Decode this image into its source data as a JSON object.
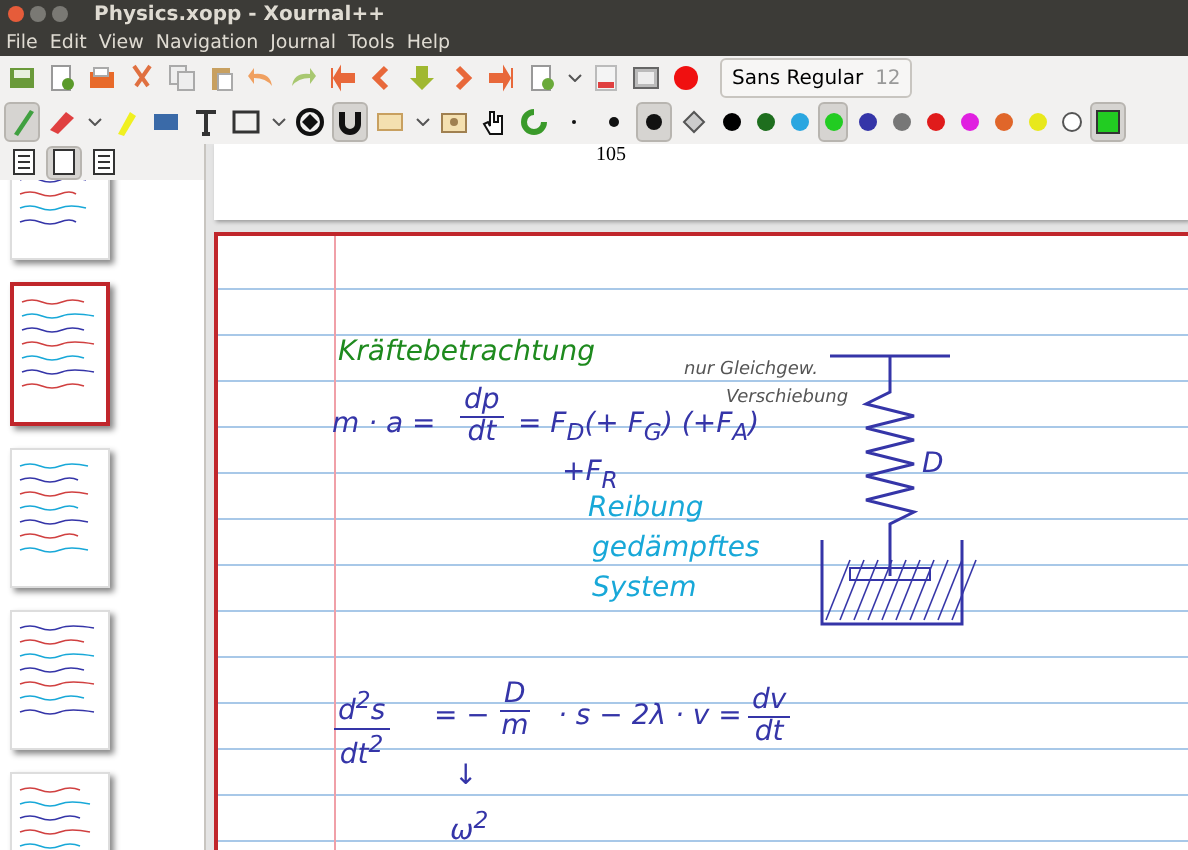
{
  "window": {
    "title": "Physics.xopp - Xournal++"
  },
  "menu": [
    "File",
    "Edit",
    "View",
    "Navigation",
    "Journal",
    "Tools",
    "Help"
  ],
  "toolbar_main": [
    {
      "kind": "save"
    },
    {
      "kind": "new"
    },
    {
      "kind": "open"
    },
    {
      "kind": "cut"
    },
    {
      "kind": "copy"
    },
    {
      "kind": "paste"
    },
    {
      "kind": "undo"
    },
    {
      "kind": "redo"
    },
    {
      "kind": "first"
    },
    {
      "kind": "prev"
    },
    {
      "kind": "goto"
    },
    {
      "kind": "next"
    },
    {
      "kind": "last"
    },
    {
      "kind": "addpage"
    },
    {
      "kind": "caret"
    },
    {
      "kind": "pdf"
    },
    {
      "kind": "fullscreen"
    },
    {
      "kind": "record"
    }
  ],
  "font_button": {
    "name": "Sans Regular",
    "size": "12"
  },
  "tools": [
    {
      "kind": "pen",
      "selected": true
    },
    {
      "kind": "eraser",
      "selected": false
    },
    {
      "kind": "caret",
      "selected": false
    },
    {
      "kind": "highlighter",
      "selected": false
    },
    {
      "kind": "tex",
      "selected": false
    },
    {
      "kind": "text",
      "selected": false
    },
    {
      "kind": "rect",
      "selected": false
    },
    {
      "kind": "caret",
      "selected": false
    },
    {
      "kind": "rotsnap",
      "selected": false
    },
    {
      "kind": "gridsnap",
      "selected": true
    },
    {
      "kind": "select",
      "selected": false
    },
    {
      "kind": "caret",
      "selected": false
    },
    {
      "kind": "image",
      "selected": false
    },
    {
      "kind": "hand",
      "selected": false
    },
    {
      "kind": "refresh",
      "selected": false
    }
  ],
  "pen_sizes": [
    {
      "selected": false
    },
    {
      "selected": false
    },
    {
      "selected": true
    }
  ],
  "colors": [
    {
      "color": "#000000",
      "selected": false
    },
    {
      "color": "#1e6e1e",
      "selected": false
    },
    {
      "color": "#2aa6e0",
      "selected": false
    },
    {
      "color": "#22cc22",
      "selected": true
    },
    {
      "color": "#3535a8",
      "selected": false
    },
    {
      "color": "#777777",
      "selected": false
    },
    {
      "color": "#e01b1b",
      "selected": false
    },
    {
      "color": "#e020e0",
      "selected": false
    },
    {
      "color": "#e0662a",
      "selected": false
    },
    {
      "color": "#e8e81c",
      "selected": false
    },
    {
      "color": "#ffffff",
      "selected": false
    }
  ],
  "sidebar": {
    "view_buttons": [
      {
        "selected": false
      },
      {
        "selected": true
      },
      {
        "selected": false
      }
    ],
    "thumbnails": [
      {
        "selected": false
      },
      {
        "selected": true
      },
      {
        "selected": false
      },
      {
        "selected": false
      },
      {
        "selected": false
      }
    ]
  },
  "page_number": "105",
  "notes": [
    {
      "kind": "text",
      "text": "Kräftebetrachtung",
      "color": "#1e8a1e"
    },
    {
      "kind": "small",
      "text": "nur Gleichgew.",
      "color": "#555555"
    },
    {
      "kind": "small",
      "text": "Verschiebung",
      "color": "#555555"
    },
    {
      "kind": "text",
      "text": "m · a =",
      "color": "#3535a8"
    },
    {
      "kind": "fraction",
      "num": "dp",
      "den": "dt",
      "color": "#3535a8"
    },
    {
      "kind": "text",
      "text": "= F$_{D}$(+ F$_{G}$) (+F$_{A}$)",
      "color": "#3535a8"
    },
    {
      "kind": "text",
      "text": "+F$_{R}$",
      "color": "#3535a8"
    },
    {
      "kind": "text",
      "text": "Reibung",
      "color": "#18a8d8"
    },
    {
      "kind": "text",
      "text": "gedämpftes",
      "color": "#18a8d8"
    },
    {
      "kind": "text",
      "text": "System",
      "color": "#18a8d8"
    },
    {
      "kind": "text",
      "text": "D",
      "color": "#3535a8"
    },
    {
      "kind": "fraction",
      "num": "d$^{2}$s",
      "den": "dt$^{2}$",
      "color": "#3535a8"
    },
    {
      "kind": "text",
      "text": "= −",
      "color": "#3535a8"
    },
    {
      "kind": "fraction",
      "num": "D",
      "den": "m",
      "color": "#3535a8"
    },
    {
      "kind": "text",
      "text": "· s  −  2λ · v  =",
      "color": "#3535a8"
    },
    {
      "kind": "fraction",
      "num": "dv",
      "den": "dt",
      "color": "#3535a8"
    },
    {
      "kind": "text",
      "text": "↓",
      "color": "#3535a8"
    },
    {
      "kind": "text",
      "text": "ω$^{2}$",
      "color": "#3535a8"
    }
  ]
}
